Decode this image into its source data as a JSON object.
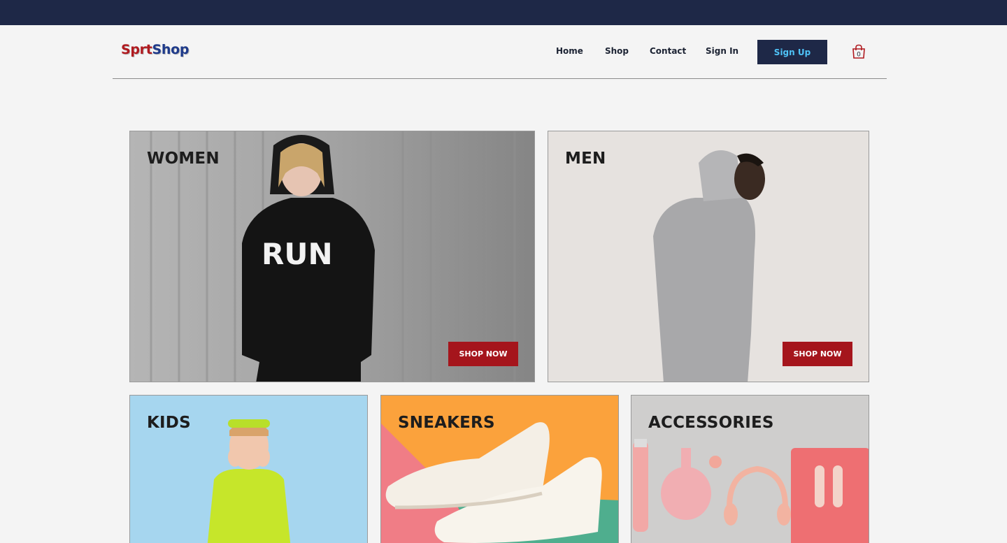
{
  "topbar": {
    "color": "#1e2847"
  },
  "brand": {
    "part1": "Sprt",
    "part2": "Shop",
    "color1": "#b01a1f",
    "color2": "#1e3a8a"
  },
  "nav": {
    "home": "Home",
    "shop": "Shop",
    "contact": "Contact",
    "signin": "Sign In",
    "signup": "Sign Up",
    "cart_count": "0",
    "cart_icon": "shopping-bag-icon"
  },
  "categories": {
    "women": {
      "title": "WOMEN",
      "cta": "SHOP NOW",
      "image": "woman in black RUN hoodie"
    },
    "men": {
      "title": "MEN",
      "cta": "SHOP NOW",
      "image": "man in grey hoodie"
    },
    "kids": {
      "title": "KIDS",
      "image": "child with swim goggles"
    },
    "sneakers": {
      "title": "SNEAKERS",
      "image": "white sneakers"
    },
    "accessories": {
      "title": "ACCESSORIES",
      "image": "pink sports accessories"
    }
  },
  "colors": {
    "cta": "#a5151c",
    "accent_text": "#4fc3f7"
  }
}
